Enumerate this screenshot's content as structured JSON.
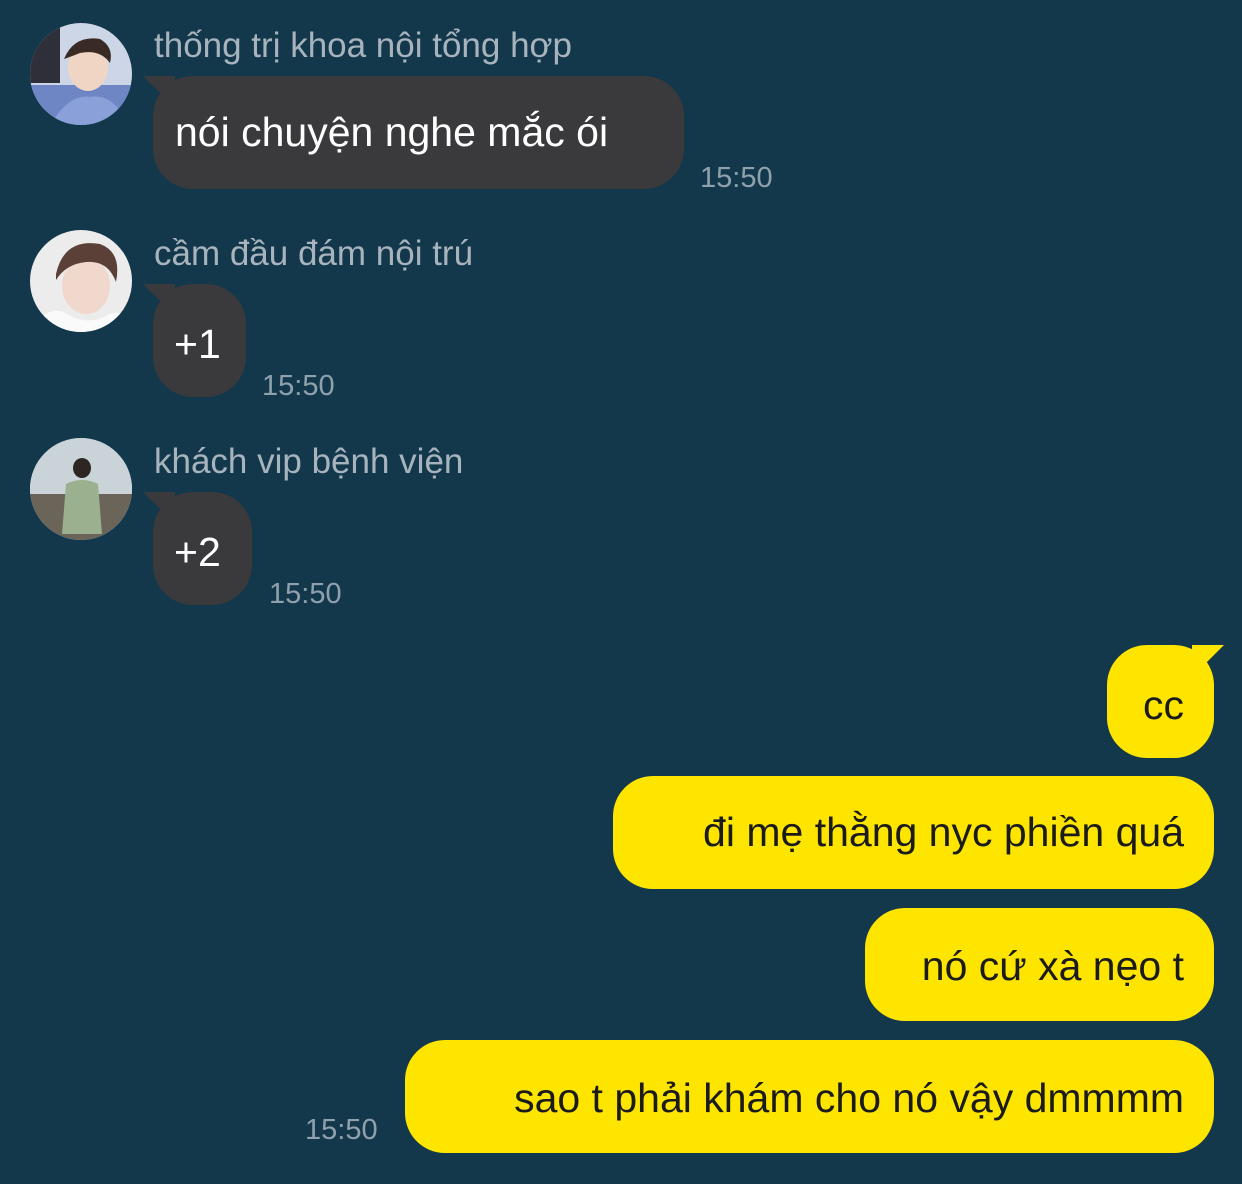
{
  "messages_in": [
    {
      "sender": "thống trị khoa nội tổng hợp",
      "text": "nói chuyện nghe mắc ói",
      "time": "15:50"
    },
    {
      "sender": "cầm đầu đám nội trú",
      "text": "+1",
      "time": "15:50"
    },
    {
      "sender": "khách vip bệnh viện",
      "text": "+2",
      "time": "15:50"
    }
  ],
  "messages_out": [
    {
      "text": "cc"
    },
    {
      "text": "đi mẹ thằng nyc phiền quá"
    },
    {
      "text": "nó cứ xà nẹo t"
    },
    {
      "text": "sao t phải khám cho nó vậy dmmmm",
      "time": "15:50"
    }
  ],
  "colors": {
    "background": "#13374b",
    "incoming_bubble": "#3a3a3c",
    "outgoing_bubble": "#fee500",
    "meta_text": "#a8b4bd"
  }
}
